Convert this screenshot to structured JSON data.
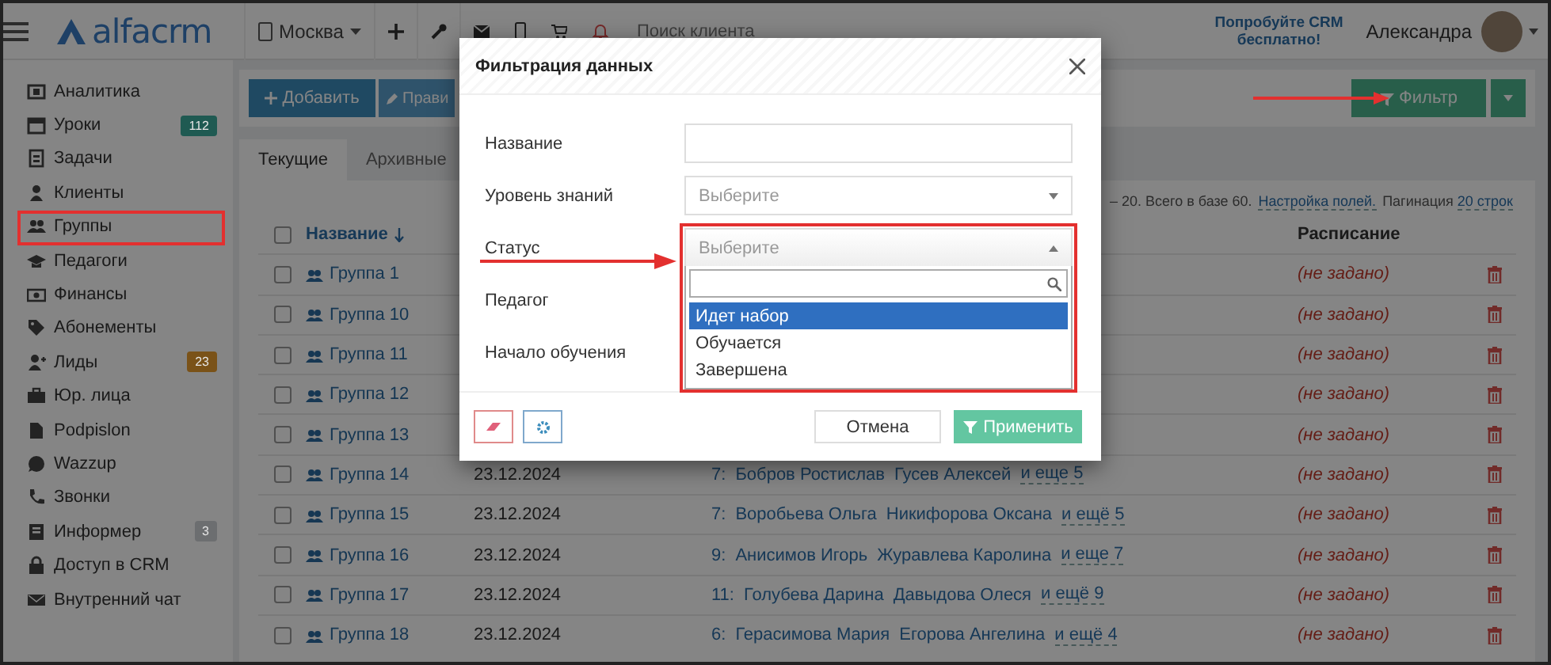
{
  "topbar": {
    "logo": "alfacrm",
    "branch": "Москва",
    "search": {
      "placeholder": "Поиск клиента"
    },
    "promo": "Попробуйте CRM бесплатно!",
    "user": "Александра"
  },
  "sidebar": {
    "items": [
      {
        "label": "Аналитика",
        "highlighted": false
      },
      {
        "label": "Уроки",
        "highlighted": false,
        "badge": {
          "text": "112",
          "color": "#1f5a52"
        }
      },
      {
        "label": "Задачи",
        "highlighted": false
      },
      {
        "label": "Клиенты",
        "highlighted": false
      },
      {
        "label": "Группы",
        "highlighted": true
      },
      {
        "label": "Педагоги",
        "highlighted": false
      },
      {
        "label": "Финансы",
        "highlighted": false
      },
      {
        "label": "Абонементы",
        "highlighted": false
      },
      {
        "label": "Лиды",
        "highlighted": false,
        "badge": {
          "text": "23",
          "color": "#7a5218"
        }
      },
      {
        "label": "Юр. лица",
        "highlighted": false
      },
      {
        "label": "Podpislon",
        "highlighted": false
      },
      {
        "label": "Wazzup",
        "highlighted": false
      },
      {
        "label": "Звонки",
        "highlighted": false
      },
      {
        "label": "Информер",
        "highlighted": false,
        "badge": {
          "text": "3",
          "color": "#6c6e70"
        }
      },
      {
        "label": "Доступ в CRM",
        "highlighted": false
      },
      {
        "label": "Внутренний чат",
        "highlighted": false
      }
    ]
  },
  "toolbar": {
    "buttons": [
      {
        "label": "Добавить",
        "kind": "add"
      },
      {
        "label": "Прави",
        "kind": "edit"
      }
    ],
    "filter": "Фильтр"
  },
  "tabs": [
    {
      "label": "Текущие",
      "selected": true
    },
    {
      "label": "Архивные",
      "selected": false
    }
  ],
  "summary": {
    "text": "– 20. Всего в базе 60.",
    "fields_link": "Настройка полей.",
    "pagination_label": "Пагинация",
    "pagination_link": "20 строк"
  },
  "table": {
    "select_all": {
      "checked": false
    },
    "name_header": "Название",
    "schedule_header": "Расписание",
    "rows": [
      {
        "checked": false,
        "name": "Группа 1",
        "schedule": "(не задано)"
      },
      {
        "checked": false,
        "name": "Группа 10",
        "schedule": "(не задано)"
      },
      {
        "checked": false,
        "name": "Группа 11",
        "schedule": "(не задано)"
      },
      {
        "checked": false,
        "name": "Группа 12",
        "schedule": "(не задано)"
      },
      {
        "checked": false,
        "name": "Группа 13",
        "schedule": "(не задано)"
      },
      {
        "checked": false,
        "name": "Группа 14",
        "date": "23.12.2024",
        "count": "7:",
        "students": [
          "Бобров Ростислав",
          "Гусев Алексей"
        ],
        "more": "и еще 5",
        "schedule": "(не задано)"
      },
      {
        "checked": false,
        "name": "Группа 15",
        "date": "23.12.2024",
        "count": "7:",
        "students": [
          "Воробьева Ольга",
          "Никифорова Оксана"
        ],
        "more": "и ещё 5",
        "schedule": "(не задано)"
      },
      {
        "checked": false,
        "name": "Группа 16",
        "date": "23.12.2024",
        "count": "9:",
        "students": [
          "Анисимов Игорь",
          "Журавлева Каролина"
        ],
        "more": "и еще 7",
        "schedule": "(не задано)"
      },
      {
        "checked": false,
        "name": "Группа 17",
        "date": "23.12.2024",
        "count": "11:",
        "students": [
          "Голубева Дарина",
          "Давыдова Олеся"
        ],
        "more": "и ещё 9",
        "schedule": "(не задано)"
      },
      {
        "checked": false,
        "name": "Группа 18",
        "date": "23.12.2024",
        "count": "6:",
        "students": [
          "Герасимова Мария",
          "Егорова Ангелина"
        ],
        "more": "и ещё 4",
        "schedule": "(не задано)"
      }
    ]
  },
  "modal": {
    "title": "Фильтрация данных",
    "fields": [
      {
        "label": "Название",
        "kind": "text",
        "highlighted": false
      },
      {
        "label": "Уровень знаний",
        "kind": "select",
        "placeholder": "Выберите",
        "expanded": false,
        "highlighted": false
      },
      {
        "label": "Статус",
        "kind": "select",
        "placeholder": "Выберите",
        "expanded": true,
        "highlighted": true,
        "options": [
          {
            "label": "Идет набор",
            "selected": true
          },
          {
            "label": "Обучается",
            "selected": false
          },
          {
            "label": "Завершена",
            "selected": false
          }
        ]
      },
      {
        "label": "Педагог"
      },
      {
        "label": "Начало обучения"
      }
    ],
    "cancel": "Отмена",
    "apply": "Применить"
  }
}
